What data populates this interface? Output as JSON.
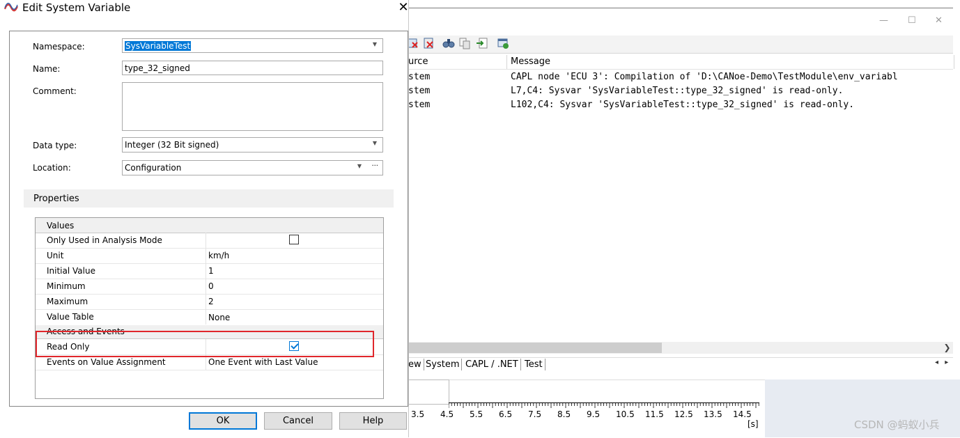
{
  "dialog": {
    "title": "Edit System Variable",
    "close_label": "✕",
    "fields": {
      "namespace_label": "Namespace:",
      "namespace_value": "SysVariableTest",
      "name_label": "Name:",
      "name_value": "type_32_signed",
      "comment_label": "Comment:",
      "comment_value": "",
      "datatype_label": "Data type:",
      "datatype_value": "Integer (32 Bit signed)",
      "location_label": "Location:",
      "location_value": "Configuration",
      "location_more": "···"
    },
    "properties_label": "Properties",
    "grid": {
      "values_category": "Values",
      "rows": [
        {
          "key": "Only Used in Analysis Mode",
          "value": "",
          "checkbox": false
        },
        {
          "key": "Unit",
          "value": "km/h"
        },
        {
          "key": "Initial Value",
          "value": "1"
        },
        {
          "key": "Minimum",
          "value": "0"
        },
        {
          "key": "Maximum",
          "value": "2"
        },
        {
          "key": "Value Table",
          "value": "None"
        }
      ],
      "access_category": "Access and Events",
      "access_rows": [
        {
          "key": "Read Only",
          "value": "",
          "checkbox": true
        },
        {
          "key": "Events on Value Assignment",
          "value": "One Event with Last Value"
        }
      ]
    },
    "buttons": {
      "ok": "OK",
      "cancel": "Cancel",
      "help": "Help"
    }
  },
  "background_window": {
    "controls": {
      "minimize": "—",
      "maximize": "☐",
      "close": "✕"
    },
    "columns": {
      "source": "urce",
      "message": "Message"
    },
    "rows": [
      {
        "source": "stem",
        "message": "CAPL node 'ECU 3': Compilation of 'D:\\CANoe-Demo\\TestModule\\env_variabl"
      },
      {
        "source": "stem",
        "message": "L7,C4: Sysvar 'SysVariableTest::type_32_signed' is read-only."
      },
      {
        "source": "stem",
        "message": "L102,C4: Sysvar 'SysVariableTest::type_32_signed' is read-only."
      }
    ],
    "scroll_right": "❯",
    "tabs": [
      "ew",
      "System",
      "CAPL / .NET",
      "Test"
    ],
    "tab_arrows": "◂ ▸",
    "axis": {
      "ticks": [
        "3.5",
        "4.5",
        "5.5",
        "6.5",
        "7.5",
        "8.5",
        "9.5",
        "10.5",
        "11.5",
        "12.5",
        "13.5",
        "14.5"
      ],
      "unit": "[s]"
    },
    "watermark": "CSDN @蚂蚁小兵"
  },
  "colors": {
    "accent": "#0078d7",
    "highlight_box": "#e0262b"
  },
  "icons": [
    "canoe-logo-icon",
    "close-icon",
    "dropdown-arrow-icon",
    "checkbox-icon",
    "check-icon",
    "toolbar-icons"
  ]
}
